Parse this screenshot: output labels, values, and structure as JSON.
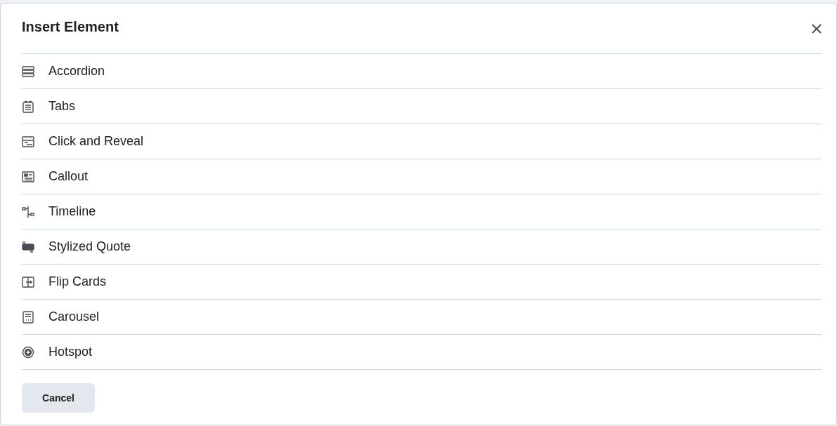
{
  "dialog": {
    "title": "Insert Element"
  },
  "items": [
    {
      "label": "Accordion",
      "kind": "accordion"
    },
    {
      "label": "Tabs",
      "kind": "tabs"
    },
    {
      "label": "Click and Reveal",
      "kind": "reveal"
    },
    {
      "label": "Callout",
      "kind": "callout"
    },
    {
      "label": "Timeline",
      "kind": "timeline"
    },
    {
      "label": "Stylized Quote",
      "kind": "quote"
    },
    {
      "label": "Flip Cards",
      "kind": "flip"
    },
    {
      "label": "Carousel",
      "kind": "carousel"
    },
    {
      "label": "Hotspot",
      "kind": "hotspot"
    }
  ],
  "buttons": [
    "Cancel"
  ]
}
